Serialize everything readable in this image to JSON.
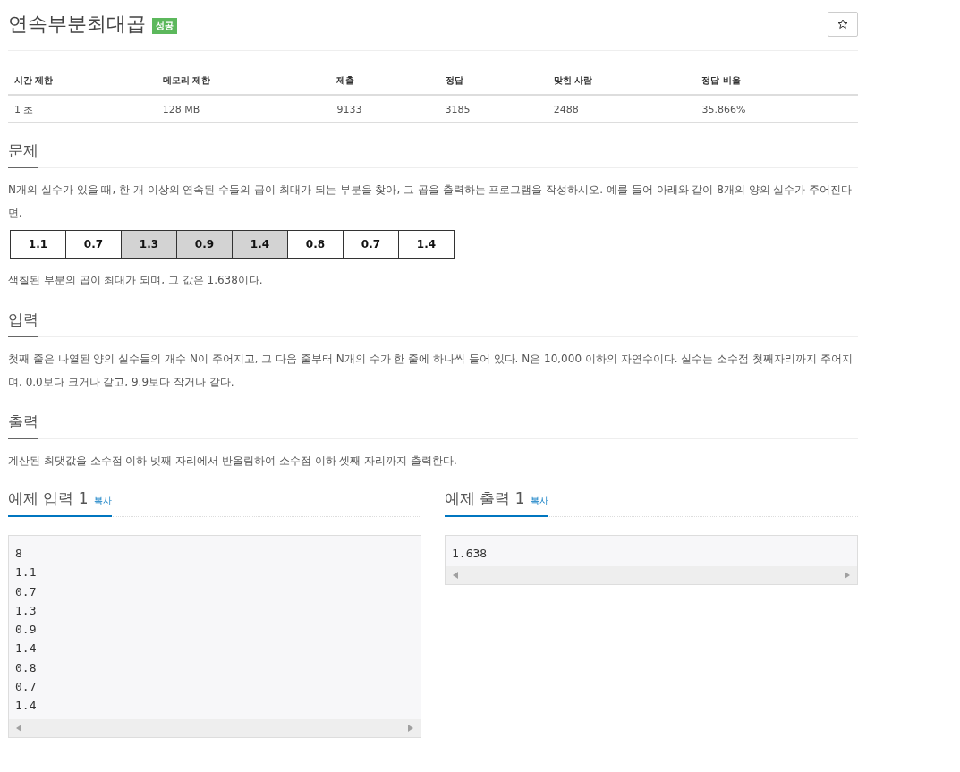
{
  "title": "연속부분최대곱",
  "badge": "성공",
  "stats": {
    "columns": [
      "시간 제한",
      "메모리 제한",
      "제출",
      "정답",
      "맞힌 사람",
      "정답 비율"
    ],
    "row": [
      "1 초",
      "128 MB",
      "9133",
      "3185",
      "2488",
      "35.866%"
    ]
  },
  "problem": {
    "heading": "문제",
    "text": "N개의 실수가 있을 때, 한 개 이상의 연속된 수들의 곱이 최대가 되는 부분을 찾아, 그 곱을 출력하는 프로그램을 작성하시오. 예를 들어 아래와 같이 8개의 양의 실수가 주어진다면,",
    "cells": [
      {
        "value": "1.1",
        "shaded": false
      },
      {
        "value": "0.7",
        "shaded": false
      },
      {
        "value": "1.3",
        "shaded": true
      },
      {
        "value": "0.9",
        "shaded": true
      },
      {
        "value": "1.4",
        "shaded": true
      },
      {
        "value": "0.8",
        "shaded": false
      },
      {
        "value": "0.7",
        "shaded": false
      },
      {
        "value": "1.4",
        "shaded": false
      }
    ],
    "after": "색칠된 부분의 곱이 최대가 되며, 그 값은 1.638이다."
  },
  "input": {
    "heading": "입력",
    "text": "첫째 줄은 나열된 양의 실수들의 개수 N이 주어지고, 그 다음 줄부터 N개의 수가 한 줄에 하나씩 들어 있다. N은 10,000 이하의 자연수이다. 실수는 소수점 첫째자리까지 주어지며, 0.0보다 크거나 같고, 9.9보다 작거나 같다."
  },
  "output": {
    "heading": "출력",
    "text": "계산된 최댓값을 소수점 이하 넷째 자리에서 반올림하여 소수점 이하 셋째 자리까지 출력한다."
  },
  "samples": [
    {
      "heading": "예제 입력 1",
      "copy": "복사",
      "lines": [
        "8",
        "1.1",
        "0.7",
        "1.3",
        "0.9",
        "1.4",
        "0.8",
        "0.7",
        "1.4"
      ]
    },
    {
      "heading": "예제 출력 1",
      "copy": "복사",
      "lines": [
        "1.638"
      ]
    }
  ]
}
